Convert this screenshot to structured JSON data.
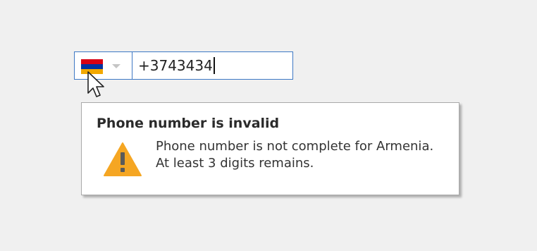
{
  "phone_field": {
    "country": {
      "name": "Armenia",
      "flag_icon": "armenia-flag-icon",
      "flag_colors": [
        "#d90012",
        "#0033a0",
        "#f2a800"
      ],
      "dropdown_icon": "chevron-down-icon"
    },
    "value": "+3743434"
  },
  "validation_tooltip": {
    "title": "Phone number is invalid",
    "icon": "warning-icon",
    "icon_color": "#f5a623",
    "message_lines": [
      "Phone number is not complete for Armenia.",
      "At least 3 digits remains."
    ]
  },
  "colors": {
    "field_border": "#3d78c4",
    "background": "#f0f0f0"
  }
}
